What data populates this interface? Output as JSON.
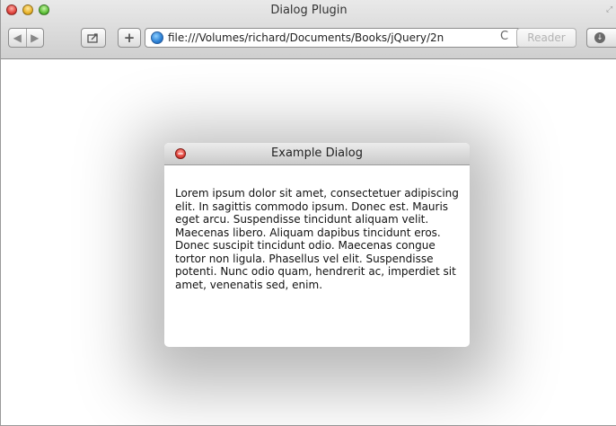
{
  "window": {
    "title": "Dialog Plugin"
  },
  "toolbar": {
    "back_icon": "back-arrow-icon",
    "forward_icon": "forward-arrow-icon",
    "share_icon": "share-icon",
    "add_label": "+",
    "url": "file:///Volumes/richard/Documents/Books/jQuery/2n",
    "reload_label": "C",
    "reader_label": "Reader"
  },
  "dialog": {
    "title": "Example Dialog",
    "body": "Lorem ipsum dolor sit amet, consectetuer adipiscing elit. In sagittis commodo ipsum. Donec est. Mauris eget arcu. Suspendisse tincidunt aliquam velit. Maecenas libero. Aliquam dapibus tincidunt eros. Donec suscipit tincidunt odio. Maecenas congue tortor non ligula. Phasellus vel elit. Suspendisse potenti. Nunc odio quam, hendrerit ac, imperdiet sit amet, venenatis sed, enim."
  },
  "colors": {
    "close_red": "#e0443e",
    "minimize_yellow": "#e9b32a",
    "zoom_green": "#5fc13a",
    "globe_blue": "#2a7fd4"
  }
}
